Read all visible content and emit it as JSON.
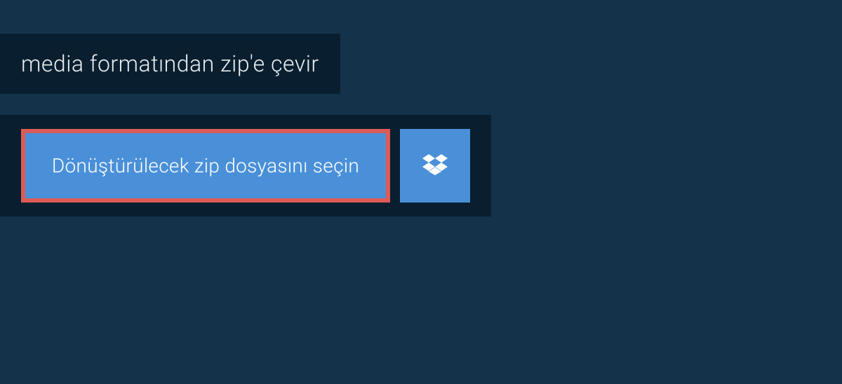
{
  "header": {
    "title": "media formatından zip'e çevir"
  },
  "upload": {
    "select_label": "Dönüştürülecek zip dosyasını seçin",
    "dropbox_icon": "dropbox"
  }
}
